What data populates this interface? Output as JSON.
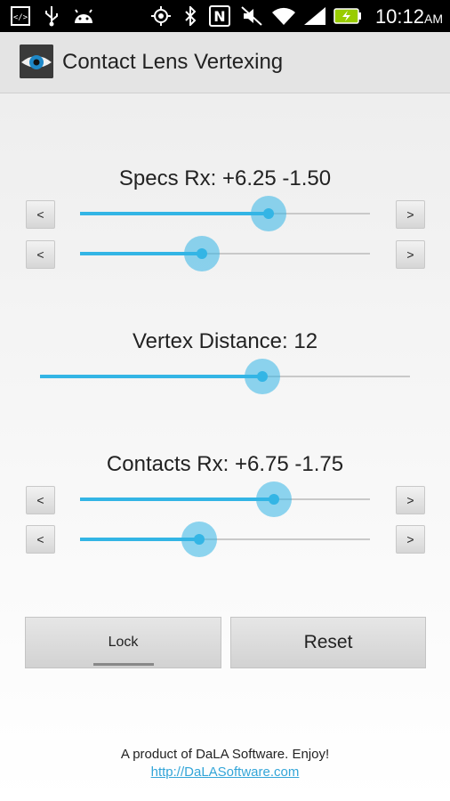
{
  "status_bar": {
    "icons": [
      "debug-icon",
      "usb-icon",
      "android-icon",
      "gps-icon",
      "bluetooth-icon",
      "nfc-icon",
      "mute-icon",
      "wifi-icon",
      "signal-icon",
      "battery-icon"
    ],
    "time": "10:12",
    "ampm": "AM"
  },
  "action_bar": {
    "title": "Contact Lens Vertexing",
    "app_icon": "eye-icon"
  },
  "specs": {
    "label": "Specs Rx: +6.25 -1.50",
    "sphere_slider": {
      "level_percent": 65
    },
    "cylinder_slider": {
      "level_percent": 42
    },
    "decrement_label": "<",
    "increment_label": ">"
  },
  "vertex": {
    "label": "Vertex Distance: 12",
    "slider": {
      "level_percent": 60
    }
  },
  "contacts": {
    "label": "Contacts Rx: +6.75 -1.75",
    "sphere_slider": {
      "level_percent": 67
    },
    "cylinder_slider": {
      "level_percent": 41
    },
    "decrement_label": "<",
    "increment_label": ">"
  },
  "buttons": {
    "lock": "Lock",
    "reset": "Reset"
  },
  "footer": {
    "text": "A product of DaLA Software.  Enjoy!",
    "link": "http://DaLASoftware.com"
  },
  "colors": {
    "accent": "#33b5e5",
    "status_bar": "#000000",
    "action_bar": "#e4e4e4"
  }
}
